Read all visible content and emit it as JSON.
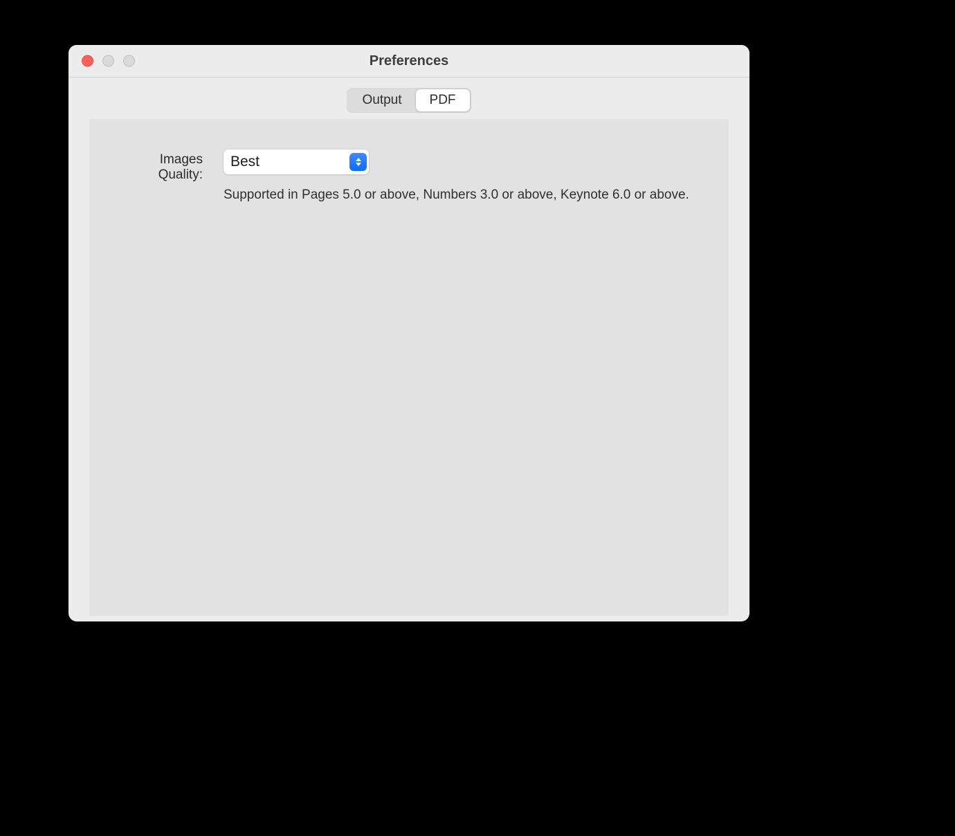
{
  "window": {
    "title": "Preferences"
  },
  "tabs": {
    "output": "Output",
    "pdf": "PDF"
  },
  "form": {
    "images_quality_label": "Images Quality:",
    "images_quality_value": "Best",
    "hint": "Supported in Pages 5.0 or above, Numbers 3.0 or above, Keynote 6.0 or above."
  }
}
